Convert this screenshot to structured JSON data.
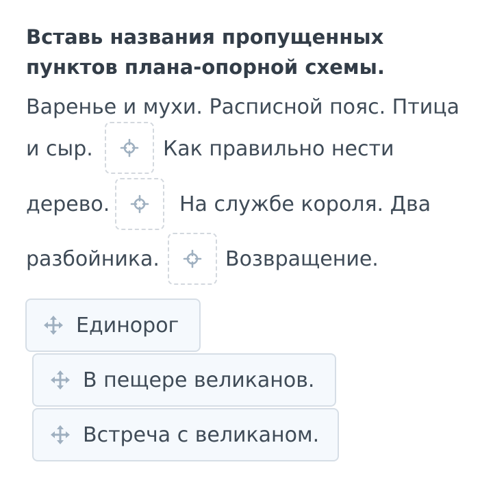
{
  "task": {
    "title_line1": "Вставь названия пропущенных",
    "title_line2": "пунктов плана-опорной схемы."
  },
  "text": {
    "line1": "Варенье и мухи. Расписной пояс. Птица",
    "line2a": "и сыр.",
    "line2b": "Как правильно нести",
    "line3a": "дерево.",
    "line3b": "На службе короля. Два",
    "line4a": "разбойника.",
    "line4b": "Возвращение."
  },
  "options": [
    {
      "label": "Единорог"
    },
    {
      "label": "В пещере великанов."
    },
    {
      "label": "Встреча с великаном."
    }
  ],
  "colors": {
    "text": "#3f4b57",
    "drop_border": "#d3d8de",
    "chip_bg": "#f5f9fd",
    "chip_border": "#d6dee6",
    "icon": "#9fb0c0"
  },
  "icons": {
    "drop_zone": "crosshair-icon",
    "option": "move-icon"
  }
}
